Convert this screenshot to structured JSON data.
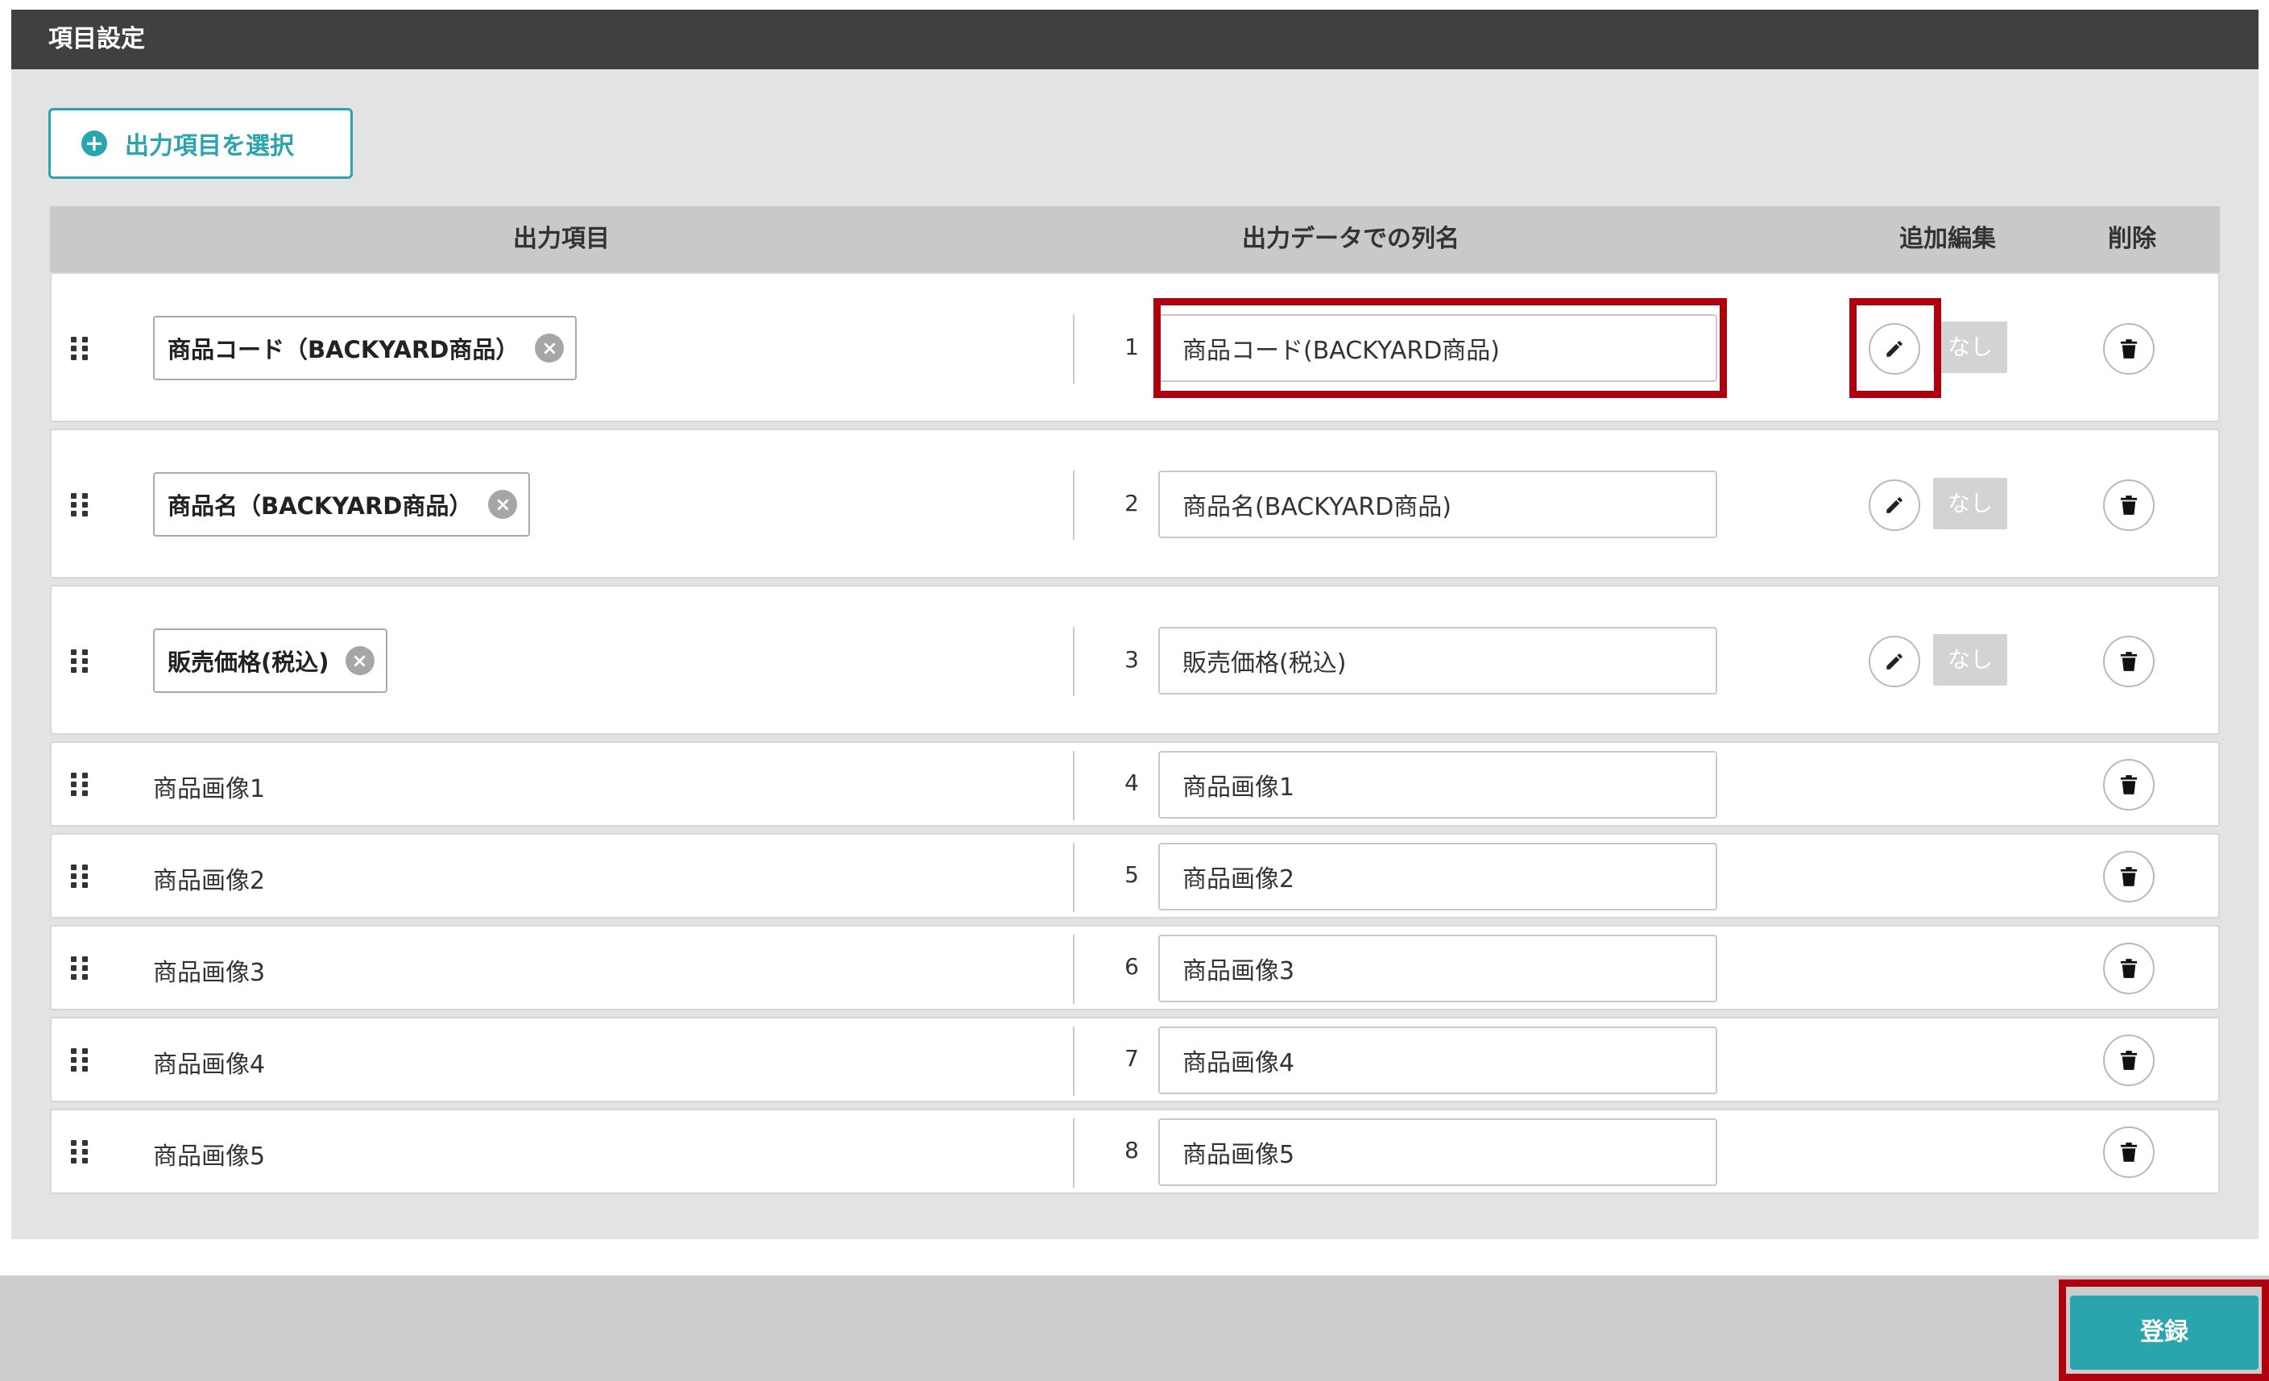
{
  "section": {
    "title": "項目設定"
  },
  "select_button": {
    "label": "出力項目を選択"
  },
  "table": {
    "headers": {
      "item": "出力項目",
      "column_name": "出力データでの列名",
      "extra_edit": "追加編集",
      "delete": "削除"
    },
    "rows": [
      {
        "item": "商品コード（BACKYARD商品）",
        "removable": true,
        "index": "1",
        "column_name": "商品コード(BACKYARD商品)",
        "extra": "なし"
      },
      {
        "item": "商品名（BACKYARD商品）",
        "removable": true,
        "index": "2",
        "column_name": "商品名(BACKYARD商品)",
        "extra": "なし"
      },
      {
        "item": "販売価格(税込)",
        "removable": true,
        "index": "3",
        "column_name": "販売価格(税込)",
        "extra": "なし"
      },
      {
        "item": "商品画像1",
        "removable": false,
        "index": "4",
        "column_name": "商品画像1"
      },
      {
        "item": "商品画像2",
        "removable": false,
        "index": "5",
        "column_name": "商品画像2"
      },
      {
        "item": "商品画像3",
        "removable": false,
        "index": "6",
        "column_name": "商品画像3"
      },
      {
        "item": "商品画像4",
        "removable": false,
        "index": "7",
        "column_name": "商品画像4"
      },
      {
        "item": "商品画像5",
        "removable": false,
        "index": "8",
        "column_name": "商品画像5"
      }
    ]
  },
  "footer": {
    "submit_label": "登録"
  },
  "colors": {
    "header_bg": "#404040",
    "accent": "#2aa5ad",
    "highlight": "#b00010",
    "panel_bg": "#e3e3e3"
  },
  "icons": {
    "drag": "drag-handle-icon",
    "remove": "close-circle-icon",
    "edit": "pencil-icon",
    "delete": "trash-icon",
    "add": "plus-circle-icon"
  }
}
